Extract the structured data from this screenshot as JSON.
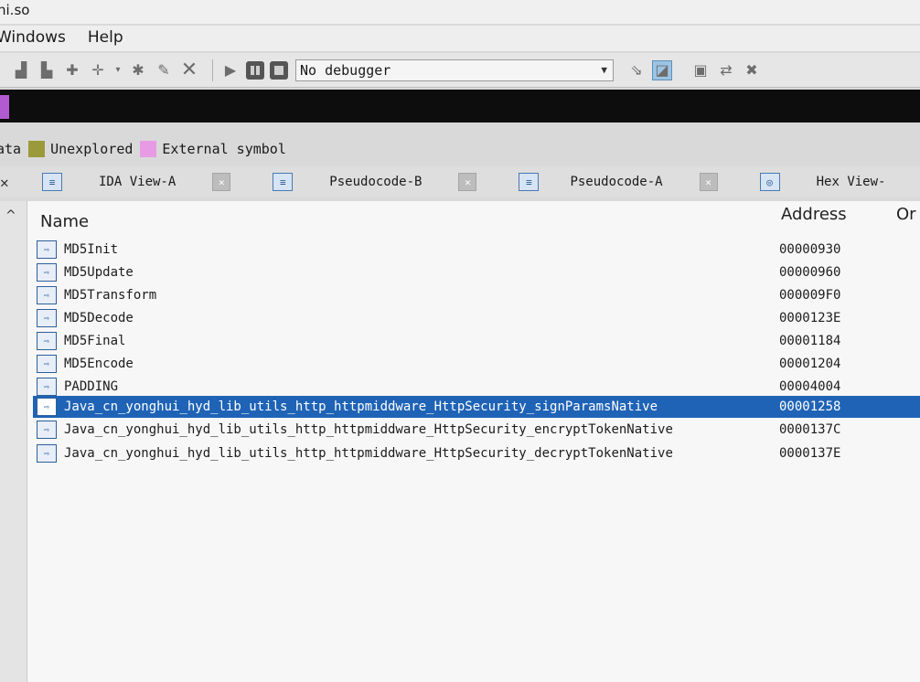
{
  "window": {
    "title": "ni.so"
  },
  "menu": {
    "items": [
      "Windows",
      "Help"
    ]
  },
  "toolbar": {
    "debugger": "No debugger",
    "icons": [
      "add-data-icon",
      "add-struct-icon",
      "add-enum-icon",
      "add-member-icon",
      "dropdown-icon",
      "delete-icon",
      "edit-icon",
      "close-icon",
      "run-icon",
      "pause-icon",
      "stop-icon",
      "debugger-select",
      "trace-icon",
      "attach-icon",
      "settings-icon",
      "detach-icon",
      "exit-icon"
    ]
  },
  "legend": {
    "items": [
      {
        "label": "ata",
        "color": ""
      },
      {
        "label": "Unexplored",
        "color": "#9b9a3a"
      },
      {
        "label": "External symbol",
        "color": "#e79be5"
      }
    ]
  },
  "tabs": [
    {
      "label": "IDA View-A"
    },
    {
      "label": "Pseudocode-B"
    },
    {
      "label": "Pseudocode-A"
    },
    {
      "label": "Hex View-"
    }
  ],
  "table": {
    "headers": {
      "name": "Name",
      "address": "Address",
      "ordinal": "Or"
    },
    "rows": [
      {
        "name": "MD5Init",
        "address": "00000930"
      },
      {
        "name": "MD5Update",
        "address": "00000960"
      },
      {
        "name": "MD5Transform",
        "address": "000009F0"
      },
      {
        "name": "MD5Decode",
        "address": "0000123E"
      },
      {
        "name": "MD5Final",
        "address": "00001184"
      },
      {
        "name": "MD5Encode",
        "address": "00001204"
      },
      {
        "name": "PADDING",
        "address": "00004004"
      },
      {
        "name": "Java_cn_yonghui_hyd_lib_utils_http_httpmiddware_HttpSecurity_signParamsNative",
        "address": "00001258",
        "selected": true
      },
      {
        "name": "Java_cn_yonghui_hyd_lib_utils_http_httpmiddware_HttpSecurity_encryptTokenNative",
        "address": "0000137C"
      },
      {
        "name": "Java_cn_yonghui_hyd_lib_utils_http_httpmiddware_HttpSecurity_decryptTokenNative",
        "address": "0000137E"
      }
    ]
  },
  "colors": {
    "selected_row": "#1f63b6",
    "nav_band": "#0d0d0d",
    "nav_marker": "#b25bd1"
  }
}
